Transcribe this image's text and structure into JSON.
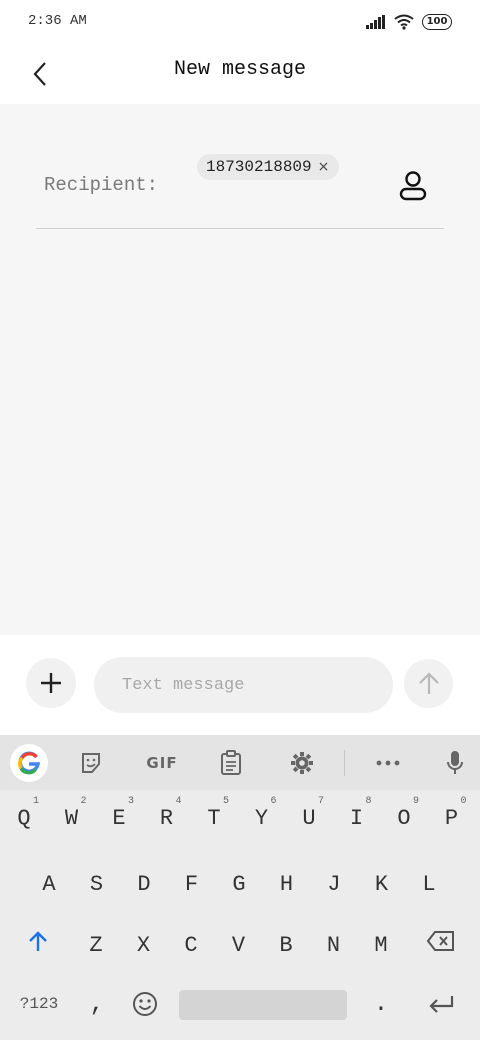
{
  "status_bar": {
    "time": "2:36 AM",
    "battery": "100"
  },
  "header": {
    "title": "New message"
  },
  "recipient": {
    "label": "Recipient:",
    "chip": "18730218809",
    "chip_remove": "×"
  },
  "compose": {
    "placeholder": "Text message"
  },
  "keyboard": {
    "toolbar": {
      "gif_label": "GIF"
    },
    "row1": [
      {
        "key": "Q",
        "hint": "1"
      },
      {
        "key": "W",
        "hint": "2"
      },
      {
        "key": "E",
        "hint": "3"
      },
      {
        "key": "R",
        "hint": "4"
      },
      {
        "key": "T",
        "hint": "5"
      },
      {
        "key": "Y",
        "hint": "6"
      },
      {
        "key": "U",
        "hint": "7"
      },
      {
        "key": "I",
        "hint": "8"
      },
      {
        "key": "O",
        "hint": "9"
      },
      {
        "key": "P",
        "hint": "0"
      }
    ],
    "row2": [
      "A",
      "S",
      "D",
      "F",
      "G",
      "H",
      "J",
      "K",
      "L"
    ],
    "row3": [
      "Z",
      "X",
      "C",
      "V",
      "B",
      "N",
      "M"
    ],
    "bottom": {
      "symbols": "?123",
      "comma": ",",
      "period": "."
    }
  },
  "colors": {
    "accent": "#1a73e8",
    "background": "#f6f6f6",
    "keyboard": "#ececec"
  }
}
